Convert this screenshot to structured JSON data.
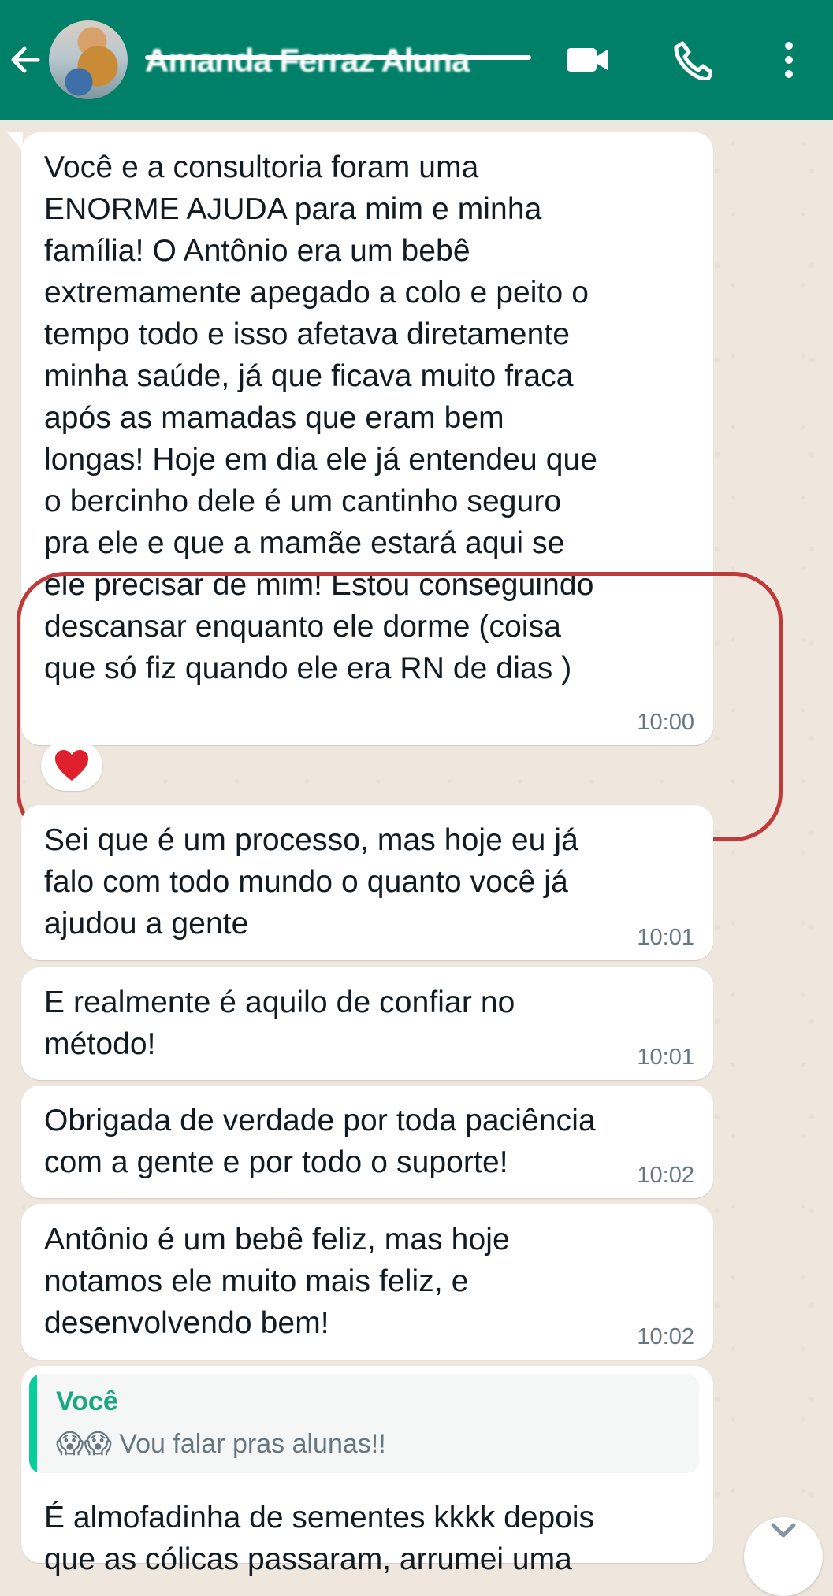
{
  "header": {
    "contact_name": "Amanda Ferraz Aluna",
    "icons": {
      "back": "back-arrow-icon",
      "video": "video-call-icon",
      "call": "phone-call-icon",
      "menu": "more-options-icon"
    },
    "colors": {
      "header": "#008069",
      "text": "#ffffff"
    }
  },
  "messages": [
    {
      "text": "Você e a consultoria foram uma\nENORME AJUDA para mim e minha\nfamília! O Antônio era um bebê\nextremamente apegado a colo e peito o\ntempo todo e isso afetava diretamente\nminha saúde, já que ficava muito fraca\napós as mamadas que eram bem\nlongas! Hoje em dia ele já entendeu que\no bercinho dele é um cantinho seguro\npra ele e que a mamãe estará aqui se\nele precisar de mim!  Estou conseguindo\ndescansar enquanto ele dorme (coisa\nque só fiz quando ele era RN de dias )",
      "time": "10:00",
      "reaction": "❤️"
    },
    {
      "text": "Sei que é um processo, mas hoje eu já\nfalo com todo mundo o quanto você já\najudou a gente",
      "time": "10:01"
    },
    {
      "text": "E realmente é aquilo de confiar no\nmétodo!",
      "time": "10:01"
    },
    {
      "text": "Obrigada de verdade por toda paciência\ncom a gente e por todo o suporte!",
      "time": "10:02"
    },
    {
      "text": "Antônio é um bebê feliz, mas hoje\nnotamos ele muito mais feliz, e\ndesenvolvendo bem!",
      "time": "10:02"
    }
  ],
  "reply_message": {
    "quoted_author": "Você",
    "quoted_text": "Vou falar pras alunas!!",
    "quoted_emoji": "😱😱",
    "text": "É almofadinha de sementes kkkk depois\nque as cólicas passaram, arrumei uma"
  },
  "colors": {
    "chat_background": "#efe7de",
    "bubble": "#ffffff",
    "timestamp": "#667781",
    "highlight": "#c0393b",
    "reply_author": "#1aa883"
  }
}
